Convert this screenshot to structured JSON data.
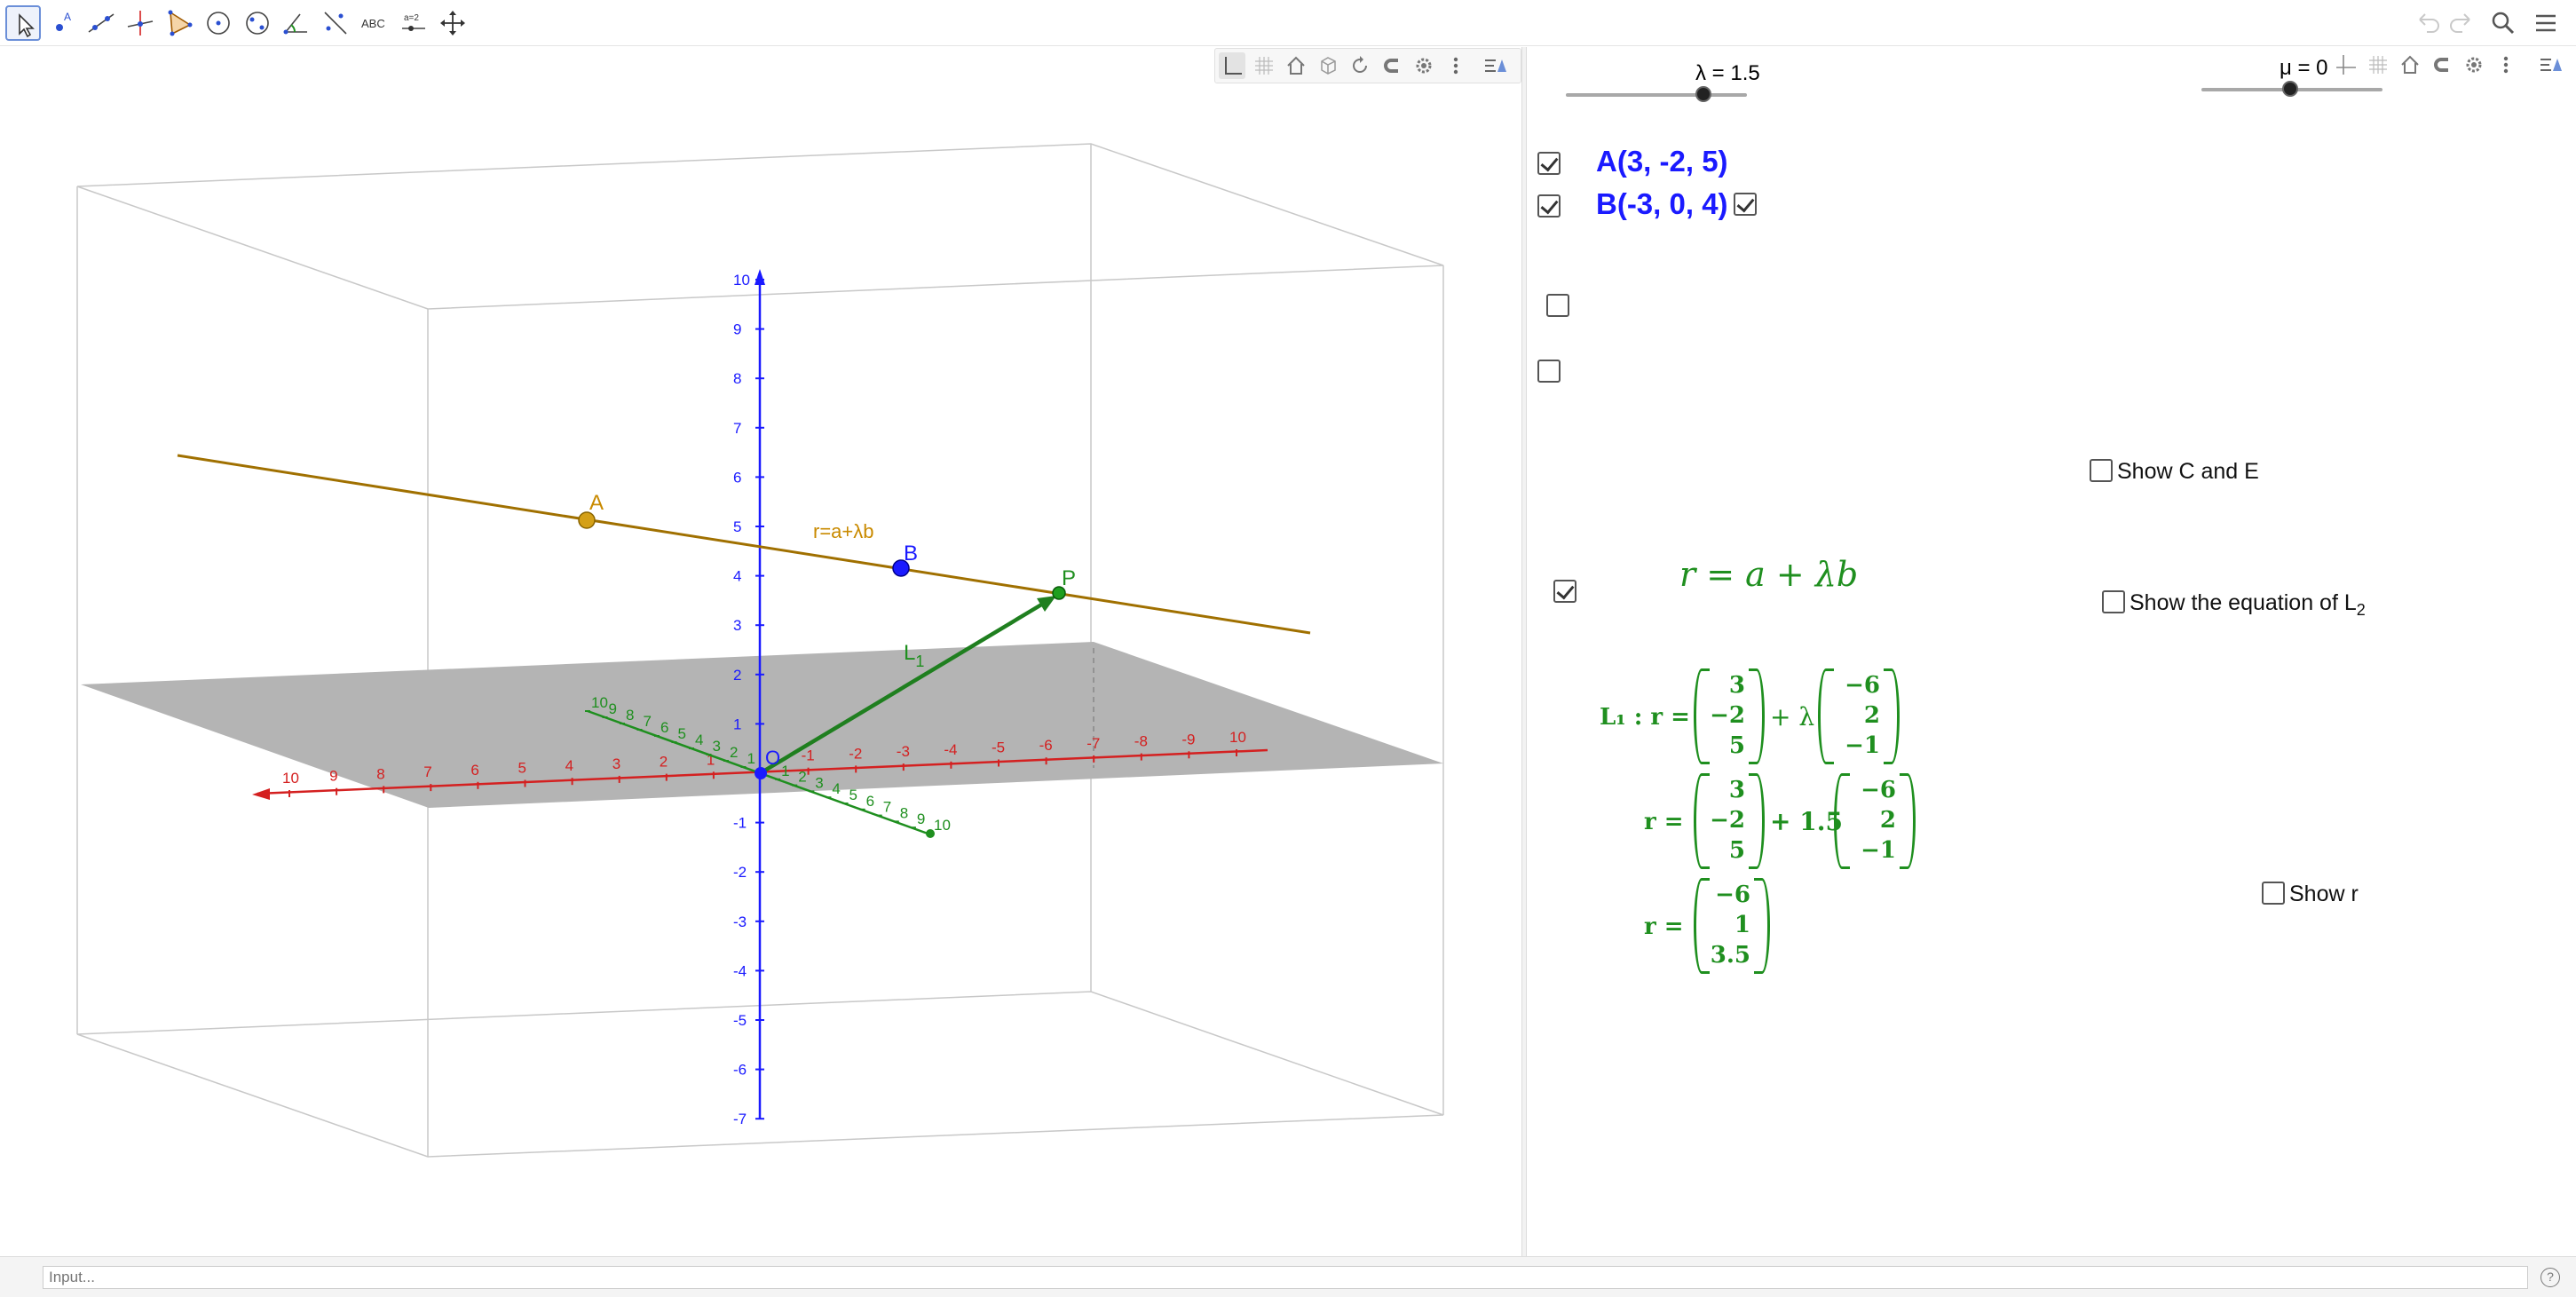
{
  "toolbar": {
    "tools": [
      {
        "name": "move-tool",
        "active": true
      },
      {
        "name": "point-tool"
      },
      {
        "name": "line-tool"
      },
      {
        "name": "perpendicular-line-tool"
      },
      {
        "name": "polygon-tool"
      },
      {
        "name": "circle-tool"
      },
      {
        "name": "conic-tool"
      },
      {
        "name": "angle-tool"
      },
      {
        "name": "reflect-tool"
      },
      {
        "name": "text-tool",
        "label": "ABC"
      },
      {
        "name": "slider-tool",
        "label": "a=2"
      },
      {
        "name": "move-view-tool"
      }
    ],
    "right_icons": [
      "undo-icon",
      "redo-icon",
      "search-icon",
      "menu-icon"
    ]
  },
  "view3d": {
    "point_A_label": "A",
    "point_B_label": "B",
    "point_P_label": "P",
    "origin_label": "O",
    "line_label": "r=a+λb",
    "vector_label": "L",
    "vector_label_sub": "1",
    "z_ticks": [
      "10",
      "9",
      "8",
      "7",
      "6",
      "5",
      "4",
      "3",
      "2",
      "1",
      "-1",
      "-2",
      "-3",
      "-4",
      "-5",
      "-6",
      "-7"
    ],
    "x_ticks_pos": [
      "10",
      "9",
      "8",
      "7",
      "6",
      "5",
      "4",
      "3",
      "2",
      "1"
    ],
    "x_ticks_neg": [
      "-1",
      "-2",
      "-3",
      "-4",
      "-5",
      "-6",
      "-7",
      "-8",
      "-9",
      "10"
    ],
    "y_ticks_back": [
      "10",
      "9",
      "8",
      "7",
      "6",
      "5",
      "4",
      "3",
      "2",
      "1"
    ],
    "y_ticks_front": [
      "1",
      "2",
      "3",
      "4",
      "5",
      "6",
      "7",
      "8",
      "9",
      "10"
    ],
    "colors": {
      "line": "#a07000",
      "point_A": "#d4a017",
      "point_B": "#1a1aff",
      "vector": "#1f7f1f",
      "x_axis": "#d42020",
      "y_axis": "#1f8f1f",
      "z_axis": "#1a1aff",
      "plane": "#b4b4b4"
    }
  },
  "sliders": {
    "lambda": {
      "label": "λ = 1.5",
      "value": 1.5
    },
    "mu": {
      "label": "μ = 0",
      "value": 0
    }
  },
  "points": {
    "A": "A(3, -2, 5)",
    "B": "B(-3, 0, 4)"
  },
  "checkboxes": {
    "show_c_and_e": "Show C and E",
    "show_l2": "Show the equation of L",
    "show_l2_sub": "2",
    "show_r": "Show r"
  },
  "equations": {
    "header": "r = a + λb",
    "l1_prefix": "L₁ : r =",
    "r_prefix": "r =",
    "plus_lambda": "+ λ",
    "plus_15": "+ 1.5",
    "a": [
      "3",
      "−2",
      "5"
    ],
    "b": [
      "−6",
      "2",
      "−1"
    ],
    "r": [
      "−6",
      "1",
      "3.5"
    ]
  },
  "input": {
    "placeholder": "Input..."
  },
  "help": "?"
}
